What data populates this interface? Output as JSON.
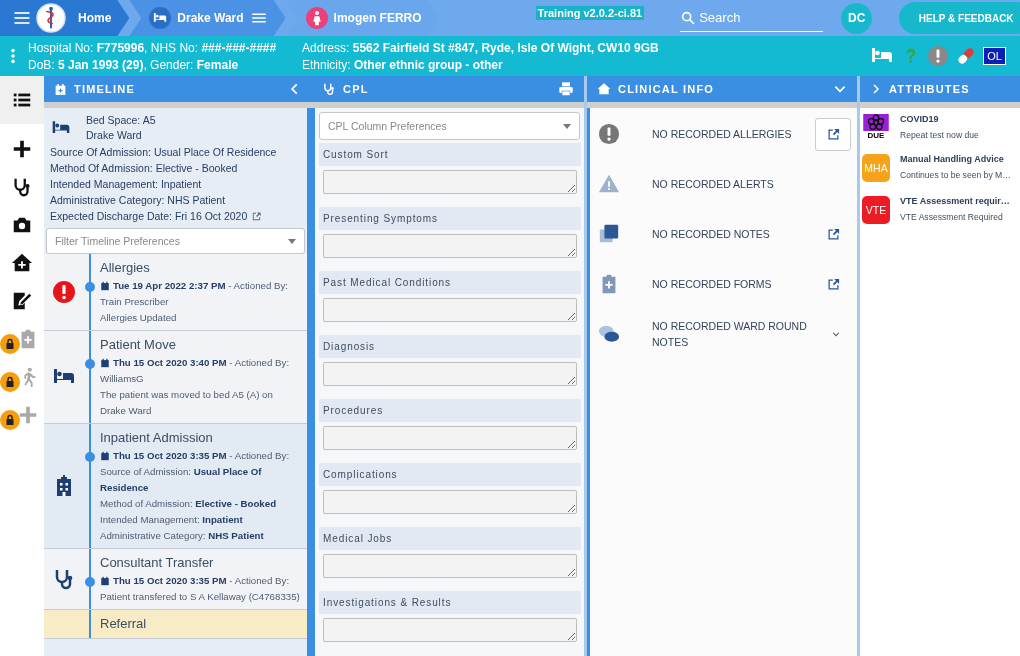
{
  "topbar": {
    "breadcrumbs": [
      {
        "kind": "home",
        "label": "Home"
      },
      {
        "kind": "ward",
        "label": "Drake Ward"
      },
      {
        "kind": "patient",
        "label": "Imogen FERRO"
      }
    ],
    "version": "Training v2.0.2-ci.81",
    "search": {
      "placeholder": "Search"
    },
    "user_initials": "DC",
    "help_button": "HELP & FEEDBACK"
  },
  "banner": {
    "left": [
      "Hospital No: **F775996**, NHS No: **###-###-####**",
      "DoB: **5 Jan 1993 (29)**, Gender: **Female**"
    ],
    "right": [
      "Address: **5562 Fairfield St #847, Ryde, Isle Of Wight, CW10 9GB**",
      "Ethnicity: **Other ethnic group - other**"
    ],
    "icons": [
      {
        "kind": "bed"
      },
      {
        "kind": "help"
      },
      {
        "kind": "alert"
      },
      {
        "kind": "pill"
      },
      {
        "kind": "initials",
        "label": "OL"
      }
    ]
  },
  "rail": [
    {
      "kind": "list",
      "selected": true,
      "locked": false
    },
    {
      "kind": "plus",
      "selected": false,
      "locked": false
    },
    {
      "kind": "stethoscope",
      "selected": false,
      "locked": false
    },
    {
      "kind": "camera",
      "selected": false,
      "locked": false
    },
    {
      "kind": "home",
      "selected": false,
      "locked": false
    },
    {
      "kind": "chart",
      "selected": false,
      "locked": false
    },
    {
      "kind": "clipboard",
      "selected": false,
      "locked": true
    },
    {
      "kind": "walk",
      "selected": false,
      "locked": true
    },
    {
      "kind": "plus",
      "selected": false,
      "locked": true
    }
  ],
  "timeline": {
    "title": "TIMELINE",
    "bed_space": "Bed Space: A5",
    "ward": "Drake Ward",
    "details": [
      "Source Of Admission: Usual Place Of Residence",
      "Method Of Admission: Elective - Booked",
      "Intended Management: Inpatient",
      "Administrative Category: NHS Patient",
      "Expected Discharge Date: Fri 16 Oct 2020"
    ],
    "filter": {
      "placeholder": "Filter Timeline Preferences"
    },
    "events": [
      {
        "kind": "allergy",
        "title": "Allergies",
        "when": "Tue 19 Apr 2022 2:37 PM",
        "by": "- Actioned By:",
        "lines": [
          "Train Prescriber",
          "Allergies Updated"
        ]
      },
      {
        "kind": "move",
        "title": "Patient Move",
        "when": "Thu 15 Oct 2020 3:40 PM",
        "by": "- Actioned By:",
        "lines": [
          "WilliamsG",
          "The patient was moved to bed A5 (A) on Drake Ward"
        ]
      },
      {
        "kind": "admission",
        "title": "Inpatient Admission",
        "when": "Thu 15 Oct 2020 3:35 PM",
        "by": "- Actioned By:",
        "lines": [
          "Source of Admission: **Usual Place Of Residence**",
          "Method of Admission: **Elective - Booked**",
          "Intended Management: **Inpatient**",
          "Administrative Category: **NHS Patient**"
        ]
      },
      {
        "kind": "transfer",
        "title": "Consultant Transfer",
        "when": "Thu 15 Oct 2020 3:35 PM",
        "by": "- Actioned By:",
        "lines": [
          "Patient transfered to S A Kellaway (C4768335)"
        ]
      },
      {
        "kind": "referral",
        "title": "Referral"
      }
    ]
  },
  "cpl": {
    "title": "CPL",
    "preferences": {
      "placeholder": "CPL Column Preferences"
    },
    "sections": [
      "Custom Sort",
      "Presenting Symptoms",
      "Past Medical Conditions",
      "Diagnosis",
      "Procedures",
      "Complications",
      "Medical Jobs",
      "Investigations & Results"
    ]
  },
  "clinical": {
    "title": "CLINICAL INFO",
    "items": [
      {
        "kind": "allergies",
        "text": "NO RECORDED ALLERGIES",
        "open_link": true,
        "boxed": true,
        "expandable": false
      },
      {
        "kind": "alerts",
        "text": "NO RECORDED ALERTS",
        "open_link": false,
        "boxed": false,
        "expandable": false
      },
      {
        "kind": "notes",
        "text": "NO RECORDED NOTES",
        "open_link": true,
        "boxed": false,
        "expandable": false
      },
      {
        "kind": "forms",
        "text": "NO RECORDED FORMS",
        "open_link": true,
        "boxed": false,
        "expandable": false
      },
      {
        "kind": "ward-round",
        "text": "NO RECORDED WARD ROUND NOTES",
        "open_link": false,
        "boxed": false,
        "expandable": true
      }
    ]
  },
  "attributes": {
    "title": "ATTRIBUTES",
    "items": [
      {
        "badge": "DUE",
        "kind": "virus",
        "color": "#9b1fd6",
        "title": "COVID19",
        "subtitle": "Repeat test now due"
      },
      {
        "badge": "MHA",
        "kind": "text",
        "color": "#f5a31a",
        "title": "Manual Handling Advice",
        "subtitle": "Continues to be seen by M…"
      },
      {
        "badge": "VTE",
        "kind": "text",
        "color": "#ec1c24",
        "title": "VTE Assessment requir…",
        "subtitle": "VTE Assessment Required"
      }
    ]
  }
}
